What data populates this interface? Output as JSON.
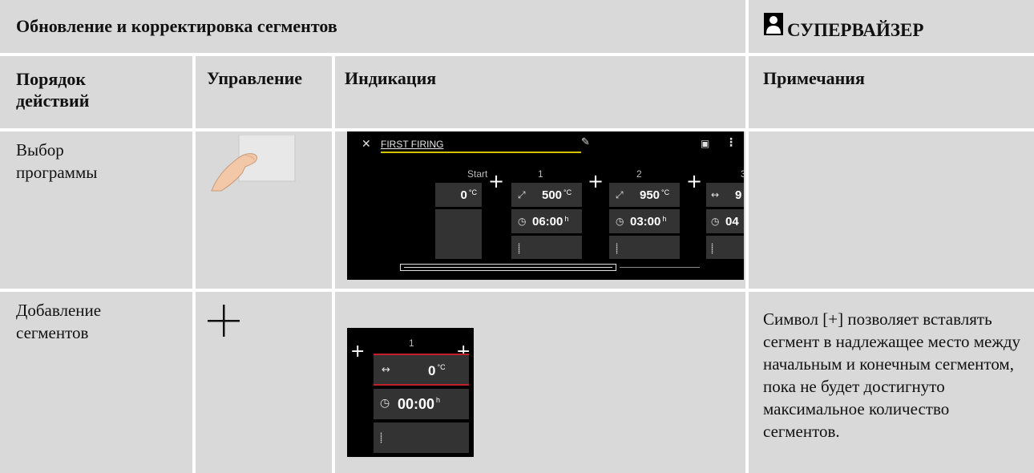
{
  "header": {
    "title": "Обновление и корректировка сегментов",
    "role": "СУПЕРВАЙЗЕР",
    "role_icon": "user-icon"
  },
  "columns": {
    "steps": "Порядок действий",
    "control": "Управление",
    "display": "Индикация",
    "notes": "Примечания"
  },
  "rows": [
    {
      "step": "Выбор программы",
      "control_icon": "finger-tap-icon",
      "note": ""
    },
    {
      "step": "Добавление сегментов",
      "control_icon": "plus-icon",
      "note": "Символ [+] позволяет вставлять сегмент в надлежащее место между начальным и конечным сегментом, пока не будет достигнуто максимальное количество сегментов."
    }
  ],
  "screen1": {
    "program_name": "FIRST FIRING",
    "start_label": "Start",
    "start_value": "0",
    "unit_temp": "°C",
    "unit_time": "h",
    "segments": [
      {
        "label": "1",
        "temp": "500",
        "time": "06:00"
      },
      {
        "label": "2",
        "temp": "950",
        "time": "03:00"
      },
      {
        "label": "3",
        "temp": "9",
        "time": "04"
      }
    ]
  },
  "screen2": {
    "segment_label": "1",
    "temp": "0",
    "time": "00:00",
    "unit_temp": "°C",
    "unit_time": "h"
  },
  "colors": {
    "cell_gray": "#d9d9d9",
    "screen_bg": "#000000",
    "tile": "#333333",
    "accent_yellow": "#d4c400",
    "accent_red": "#c0202a"
  }
}
